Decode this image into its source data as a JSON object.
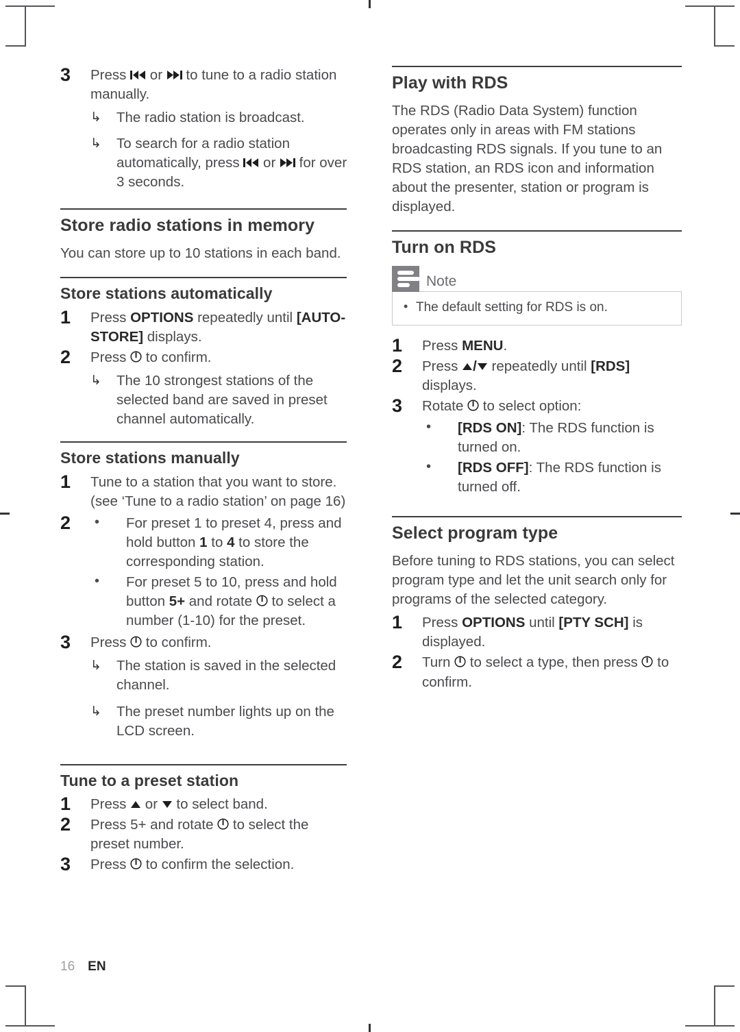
{
  "page": {
    "number": "16",
    "language": "EN"
  },
  "icons": {
    "prev": "skip-backward-icon",
    "next": "skip-forward-icon",
    "power": "power-standby-icon",
    "up": "navigate-up-icon",
    "down": "navigate-down-icon",
    "arrow_result": "↳",
    "bullet": "•"
  },
  "left_column": {
    "step3": {
      "num": "3",
      "text_a": "Press ",
      "text_b": " or ",
      "text_c": " to tune to a radio station manually.",
      "results": [
        {
          "text": "The radio station is broadcast."
        },
        {
          "text_a": "To search for a radio station automatically, press ",
          "text_b": " or ",
          "text_c": " for over 3 seconds."
        }
      ]
    },
    "store_memory": {
      "title": "Store radio stations in memory",
      "intro": "You can store up to 10 stations in each band."
    },
    "store_auto": {
      "title": "Store stations automatically",
      "steps": [
        {
          "num": "1",
          "pre": "Press ",
          "bold": "OPTIONS",
          "mid": " repeatedly until ",
          "bold2": "[AUTO-STORE]",
          "post": " displays."
        },
        {
          "num": "2",
          "pre": "Press ",
          "post": " to confirm."
        }
      ],
      "result": "The 10 strongest stations of the selected band are saved in preset channel automatically."
    },
    "store_manual": {
      "title": "Store stations manually",
      "step1": {
        "num": "1",
        "text": "Tune to a station that you want to store. (see ‘Tune to a radio station’ on page 16)"
      },
      "step2": {
        "num": "2",
        "text": "",
        "bullets": [
          {
            "pre": "For preset 1 to preset 4, press and hold button ",
            "bold": "1",
            "mid": " to ",
            "bold2": "4",
            "post": " to store the corresponding station."
          },
          {
            "pre": "For preset 5 to 10, press and hold button ",
            "bold": "5+",
            "mid": " and rotate ",
            "post": " to select a number (1-10) for the preset."
          }
        ]
      },
      "step3": {
        "num": "3",
        "pre": "Press ",
        "post": " to confirm."
      },
      "results": [
        "The station is saved in the selected channel.",
        "The preset number lights up on the LCD screen."
      ]
    },
    "tune_preset": {
      "title": "Tune to a preset station",
      "steps": [
        {
          "num": "1",
          "pre": "Press ",
          "mid": " or ",
          "post": " to select band."
        },
        {
          "num": "2",
          "pre": "Press 5+ and rotate ",
          "post": " to select the preset number."
        },
        {
          "num": "3",
          "pre": "Press ",
          "post": " to confirm the selection."
        }
      ]
    }
  },
  "right_column": {
    "play_rds": {
      "title": "Play with RDS",
      "body": "The RDS (Radio Data System) function operates only in areas with FM stations broadcasting RDS signals. If you tune to an RDS station, an RDS icon and information about the presenter, station or program is displayed."
    },
    "turn_on_rds": {
      "title": "Turn on RDS",
      "note": {
        "label": "Note",
        "items": [
          "The default setting for RDS is on."
        ]
      },
      "steps": [
        {
          "num": "1",
          "pre": "Press ",
          "bold": "MENU",
          "post": "."
        },
        {
          "num": "2",
          "pre": "Press ",
          "mid": " repeatedly until ",
          "bold2": "[RDS]",
          "post": " displays."
        },
        {
          "num": "3",
          "pre": "Rotate ",
          "post": " to select option:"
        }
      ],
      "options": [
        {
          "bold": "[RDS ON]",
          "text": ": The RDS function is turned on."
        },
        {
          "bold": "[RDS OFF]",
          "text": ": The RDS function is turned off."
        }
      ]
    },
    "select_program_type": {
      "title": "Select program type",
      "body": "Before tuning to RDS stations, you can select program type and let the unit search only for programs of the selected category.",
      "steps": [
        {
          "num": "1",
          "pre": "Press ",
          "bold": "OPTIONS",
          "mid": " until ",
          "bold2": "[PTY SCH]",
          "post": " is displayed."
        },
        {
          "num": "2",
          "pre": "Turn ",
          "mid": " to select a type, then press ",
          "post": " to confirm."
        }
      ]
    }
  },
  "colors": {
    "text": "#4a4a4e",
    "heading": "#3a3a3c",
    "rule": "#3c3c3f",
    "note_icon_bg": "#808085",
    "note_border": "#c9c9cc"
  }
}
